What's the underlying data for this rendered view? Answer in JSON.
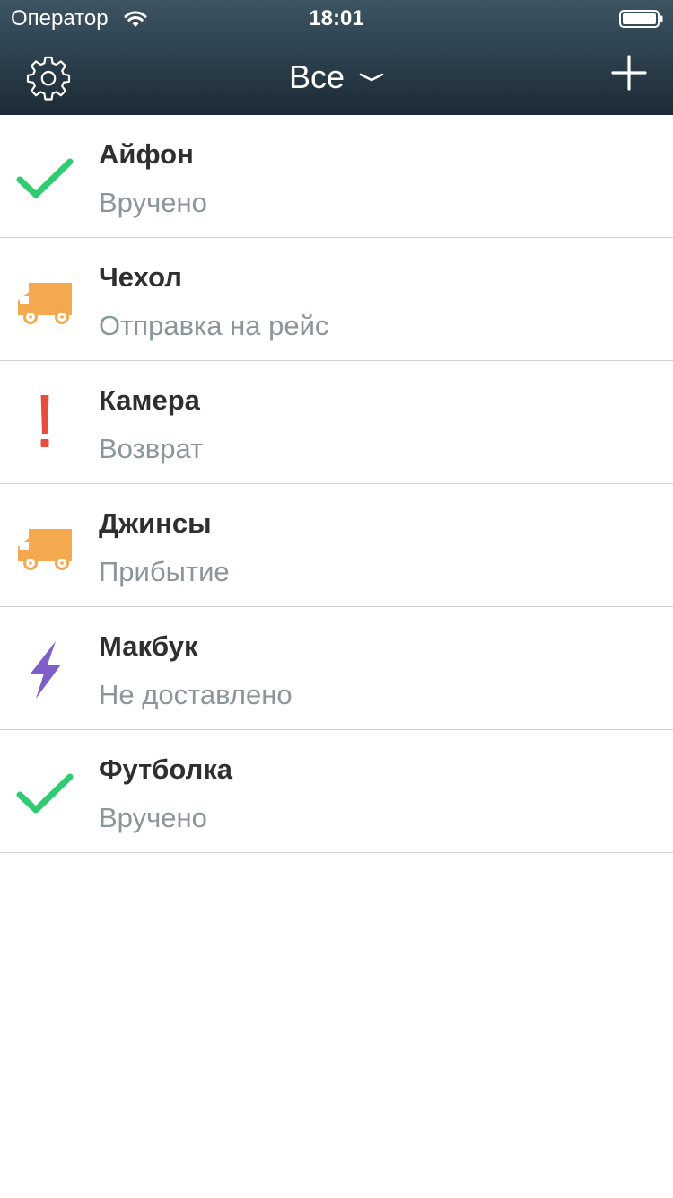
{
  "status_bar": {
    "carrier": "Оператор",
    "time": "18:01"
  },
  "nav": {
    "filter_label": "Все"
  },
  "colors": {
    "delivered": "#2ecc71",
    "in_transit": "#f5a94e",
    "problem": "#e74c3c",
    "failed": "#7e5fc9"
  },
  "items": [
    {
      "title": "Айфон",
      "status": "Вручено",
      "icon": "check-icon"
    },
    {
      "title": "Чехол",
      "status": "Отправка на рейс",
      "icon": "truck-icon"
    },
    {
      "title": "Камера",
      "status": "Возврат",
      "icon": "exclamation-icon"
    },
    {
      "title": "Джинсы",
      "status": "Прибытие",
      "icon": "truck-icon"
    },
    {
      "title": "Макбук",
      "status": "Не доставлено",
      "icon": "lightning-icon"
    },
    {
      "title": "Футболка",
      "status": "Вручено",
      "icon": "check-icon"
    }
  ]
}
